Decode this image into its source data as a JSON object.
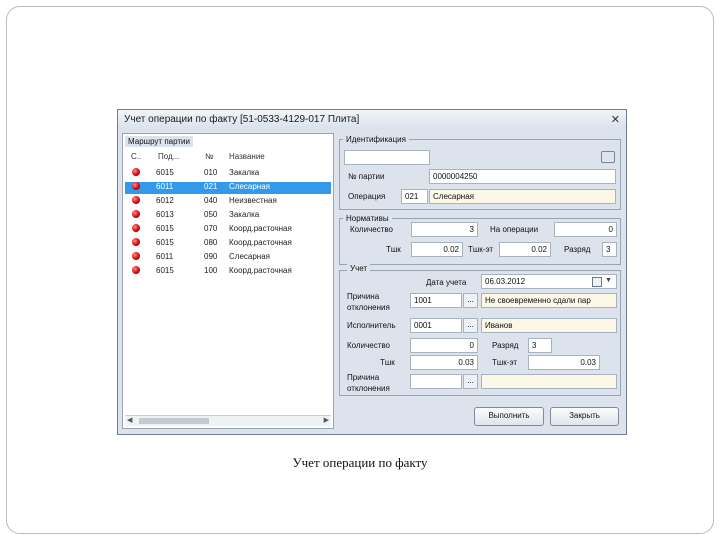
{
  "window": {
    "title": "Учет операции по факту [51-0533-4129-017 Плита]"
  },
  "route": {
    "group_title": "Маршрут партии",
    "headers": {
      "status": "С..",
      "pod": "Под...",
      "num": "№",
      "name": "Название"
    },
    "rows": [
      {
        "pod": "6015",
        "num": "010",
        "name": "Закалка"
      },
      {
        "pod": "6011",
        "num": "021",
        "name": "Слесарная",
        "selected": true
      },
      {
        "pod": "6012",
        "num": "040",
        "name": "Неизвестная"
      },
      {
        "pod": "6013",
        "num": "050",
        "name": "Закалка"
      },
      {
        "pod": "6015",
        "num": "070",
        "name": "Коорд.расточная"
      },
      {
        "pod": "6015",
        "num": "080",
        "name": "Коорд.расточная"
      },
      {
        "pod": "6011",
        "num": "090",
        "name": "Слесарная"
      },
      {
        "pod": "6015",
        "num": "100",
        "name": "Коорд.расточная"
      }
    ]
  },
  "identification": {
    "group_title": "Идентификация",
    "batch_label": "№ партии",
    "batch_value": "0000004250",
    "operation_label": "Операция",
    "operation_num": "021",
    "operation_name": "Слесарная"
  },
  "norms": {
    "group_title": "Нормативы",
    "quantity_label": "Количество",
    "quantity_value": "3",
    "at_operation_label": "На операции",
    "at_operation_value": "0",
    "tsh_label": "Тшк",
    "tsh_value": "0.02",
    "tsh_sum_label": "Тшк-эт",
    "tsh_sum_value": "0.02",
    "grade_label": "Разряд",
    "grade_value": "3"
  },
  "accounting": {
    "group_title": "Учет",
    "date_label": "Дата учета",
    "date_value": "06.03.2012",
    "reason_label": "Причина отклонения",
    "reason_code": "1001",
    "reason_text": "Не своевременно сдали пар",
    "executor_label": "Исполнитель",
    "executor_code": "0001",
    "executor_name": "Иванов",
    "quantity_label": "Количество",
    "quantity_value": "0",
    "grade_label": "Разряд",
    "grade_value": "3",
    "tsh_label": "Тшк",
    "tsh_value": "0.03",
    "tsh_sum_label": "Тшк-эт",
    "tsh_sum_value": "0.03",
    "reason2_label": "Причина отклонения",
    "reason2_code": "",
    "reason2_text": ""
  },
  "buttons": {
    "execute": "Выполнить",
    "close": "Закрыть",
    "dots": "..."
  },
  "caption": "Учет операции по факту"
}
